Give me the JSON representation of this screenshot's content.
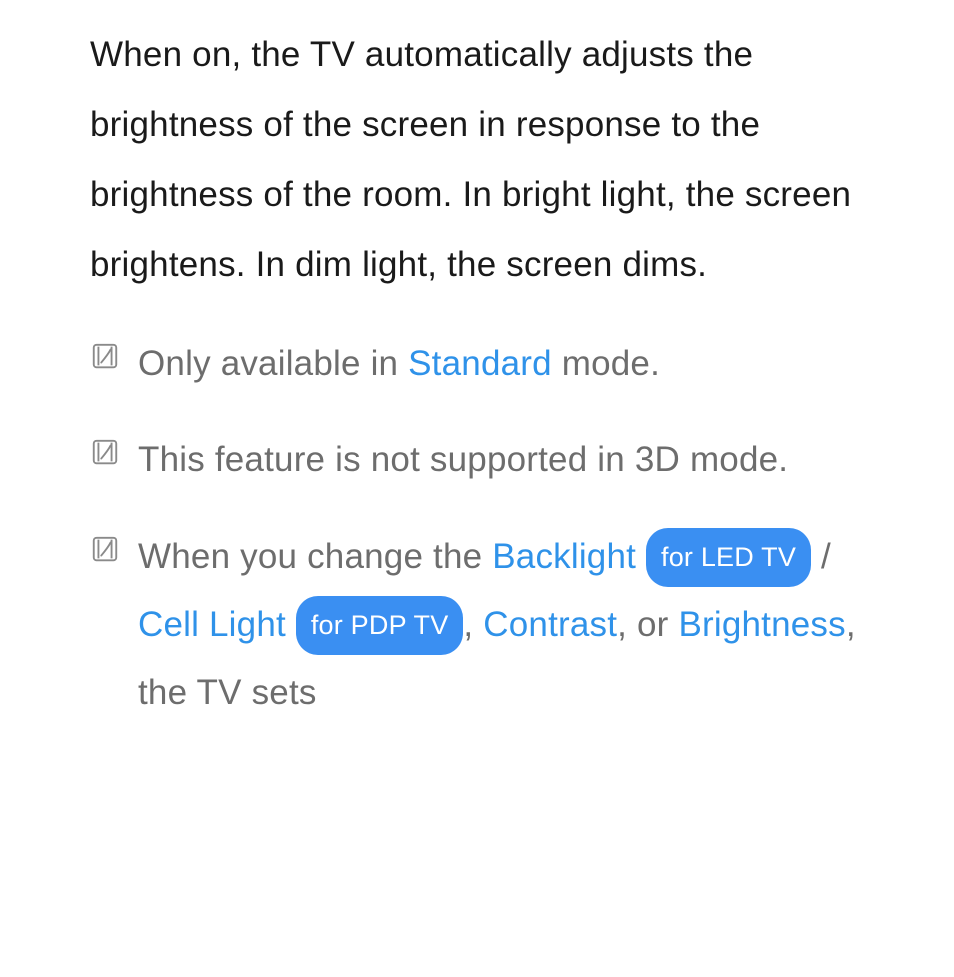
{
  "paragraph": "When on, the TV automatically adjusts the brightness of the screen in response to the brightness of the room. In bright light, the screen brightens. In dim light, the screen dims.",
  "notes": {
    "n1": {
      "t1": "Only available in ",
      "link1": "Standard",
      "t2": " mode."
    },
    "n2": {
      "t1": "This feature is not supported in 3D mode."
    },
    "n3": {
      "t1": "When you change the ",
      "link_backlight": "Backlight",
      "pill_led": "for LED TV",
      "slash": " / ",
      "link_cell": "Cell Light",
      "pill_pdp": "for PDP TV",
      "comma1": ", ",
      "link_contrast": "Contrast",
      "comma2": ", or ",
      "link_brightness": "Brightness",
      "tail": ", the TV sets"
    }
  }
}
